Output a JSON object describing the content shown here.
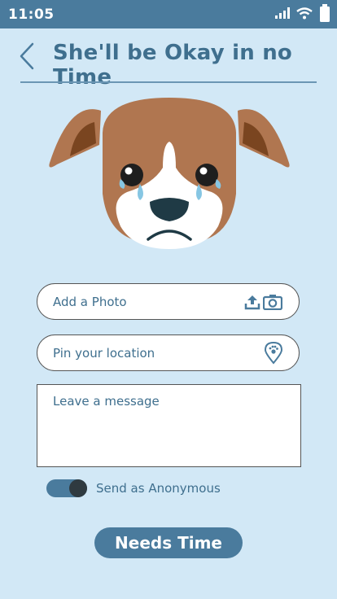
{
  "status_bar": {
    "time": "11:05"
  },
  "header": {
    "title": "She'll be Okay in no Time"
  },
  "form": {
    "photo_label": "Add a Photo",
    "location_label": "Pin your location",
    "message_placeholder": "Leave a message",
    "anonymous_label": "Send as Anonymous",
    "anonymous_on": true
  },
  "cta": {
    "label": "Needs Time"
  },
  "colors": {
    "background": "#d2e8f6",
    "accent": "#4a7b9d",
    "text": "#3f6f8e"
  }
}
